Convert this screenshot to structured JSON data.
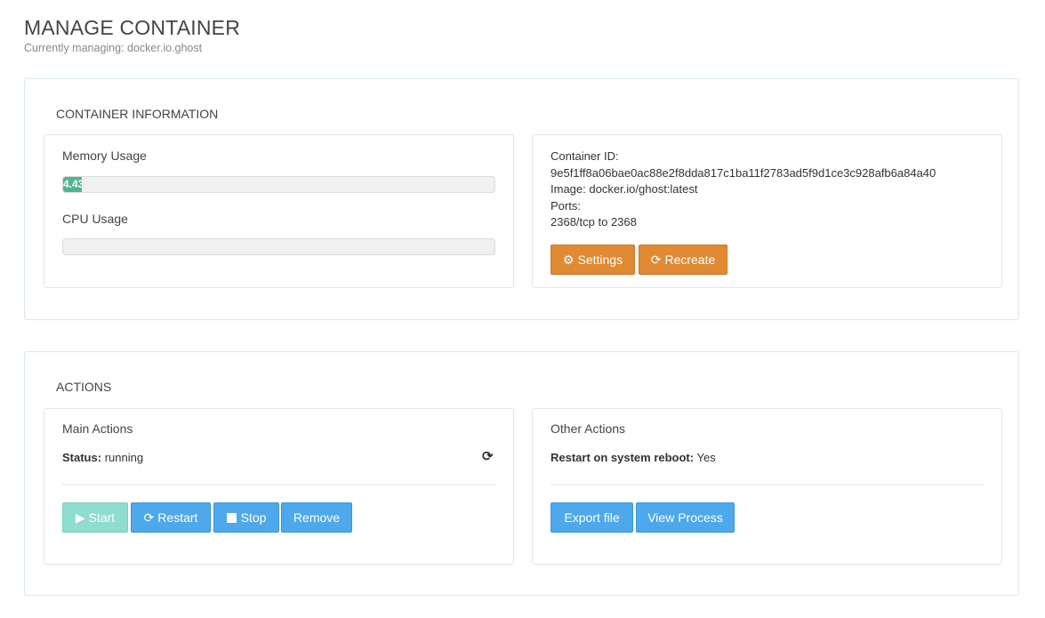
{
  "header": {
    "title": "MANAGE CONTAINER",
    "subtitle": "Currently managing: docker.io.ghost"
  },
  "container_info": {
    "heading": "CONTAINER INFORMATION",
    "memory_label": "Memory Usage",
    "memory_value_text": "4.43",
    "memory_percent": 4.43,
    "cpu_label": "CPU Usage",
    "cpu_percent": 0,
    "container_id_label": "Container ID:",
    "container_id": "9e5f1ff8a06bae0ac88e2f8dda817c1ba11f2783ad5f9d1ce3c928afb6a84a40",
    "image_text": "Image: docker.io/ghost:latest",
    "ports_label": "Ports:",
    "ports_value": "2368/tcp to 2368",
    "settings_label": "Settings",
    "recreate_label": "Recreate"
  },
  "actions": {
    "heading": "ACTIONS",
    "main_title": "Main Actions",
    "status_label": "Status:",
    "status_value": "running",
    "start_label": "Start",
    "restart_label": "Restart",
    "stop_label": "Stop",
    "remove_label": "Remove",
    "other_title": "Other Actions",
    "reboot_label": "Restart on system reboot:",
    "reboot_value": "Yes",
    "export_label": "Export file",
    "view_process_label": "View Process"
  },
  "colors": {
    "warning": "#e08a33",
    "info": "#4da9ec",
    "success_bar": "#52b394",
    "disabled": "#8fdcd0"
  },
  "icons": {
    "settings": "gear-icon",
    "recreate": "refresh-icon",
    "start": "play-icon",
    "restart": "refresh-icon",
    "stop": "stop-icon",
    "status_refresh": "refresh-icon"
  }
}
